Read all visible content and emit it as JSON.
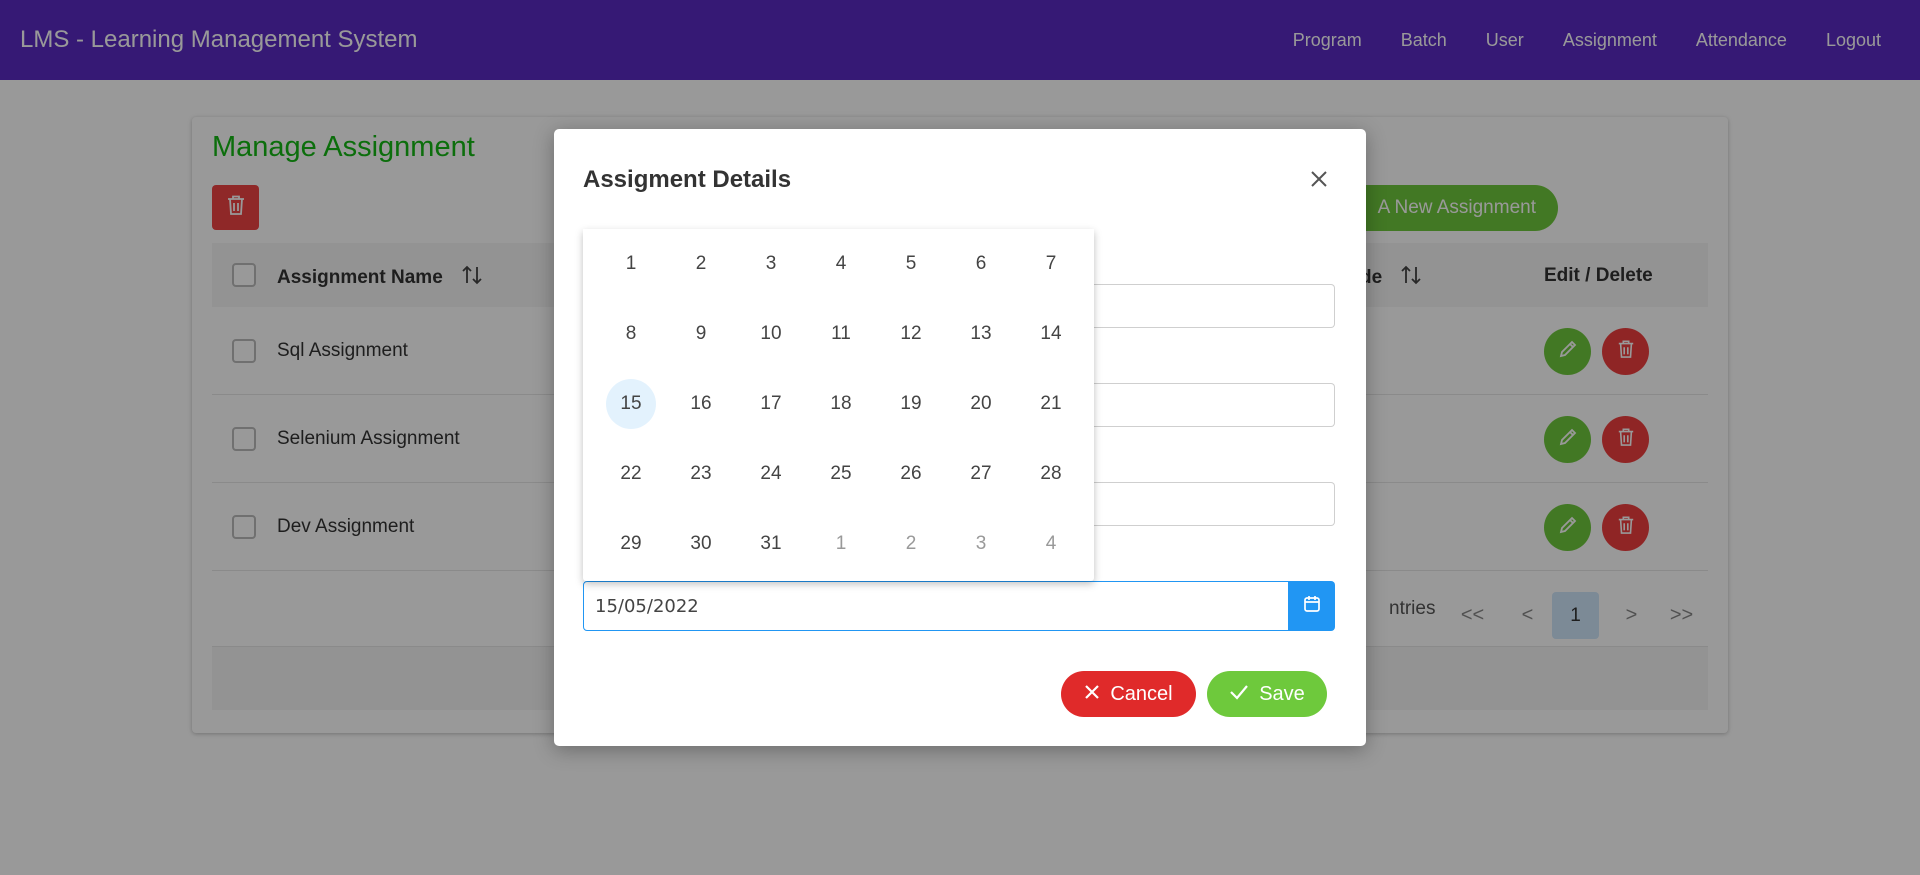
{
  "app": {
    "title": "LMS - Learning Management System",
    "nav": [
      "Program",
      "Batch",
      "User",
      "Assignment",
      "Attendance",
      "Logout"
    ]
  },
  "page": {
    "title": "Manage Assignment",
    "new_button": "A New Assignment",
    "columns": {
      "name": "Assignment Name",
      "grade": "de",
      "actions": "Edit / Delete"
    },
    "rows": [
      {
        "name": "Sql Assignment"
      },
      {
        "name": "Selenium Assignment"
      },
      {
        "name": "Dev Assignment"
      }
    ],
    "paginator": {
      "entries_text": "ntries",
      "first": "<<",
      "prev": "<",
      "current": "1",
      "next": ">",
      "last": ">>"
    }
  },
  "dialog": {
    "title": "Assigment Details",
    "date_value": "15/05/2022",
    "cancel_label": "Cancel",
    "save_label": "Save"
  },
  "calendar": {
    "selected": "15",
    "days": [
      {
        "d": "1"
      },
      {
        "d": "2"
      },
      {
        "d": "3"
      },
      {
        "d": "4"
      },
      {
        "d": "5"
      },
      {
        "d": "6"
      },
      {
        "d": "7"
      },
      {
        "d": "8"
      },
      {
        "d": "9"
      },
      {
        "d": "10"
      },
      {
        "d": "11"
      },
      {
        "d": "12"
      },
      {
        "d": "13"
      },
      {
        "d": "14"
      },
      {
        "d": "15"
      },
      {
        "d": "16"
      },
      {
        "d": "17"
      },
      {
        "d": "18"
      },
      {
        "d": "19"
      },
      {
        "d": "20"
      },
      {
        "d": "21"
      },
      {
        "d": "22"
      },
      {
        "d": "23"
      },
      {
        "d": "24"
      },
      {
        "d": "25"
      },
      {
        "d": "26"
      },
      {
        "d": "27"
      },
      {
        "d": "28"
      },
      {
        "d": "29"
      },
      {
        "d": "30"
      },
      {
        "d": "31"
      },
      {
        "d": "1",
        "other": true
      },
      {
        "d": "2",
        "other": true
      },
      {
        "d": "3",
        "other": true
      },
      {
        "d": "4",
        "other": true
      }
    ]
  },
  "colors": {
    "header": "#5b2bc4",
    "title_green": "#14b814",
    "success": "#6ec93c",
    "danger": "#e02a2a",
    "primary": "#2196f3"
  },
  "icons": [
    "trash-icon",
    "sort-icon",
    "pencil-icon",
    "close-icon",
    "calendar-icon",
    "x-icon",
    "check-icon"
  ]
}
